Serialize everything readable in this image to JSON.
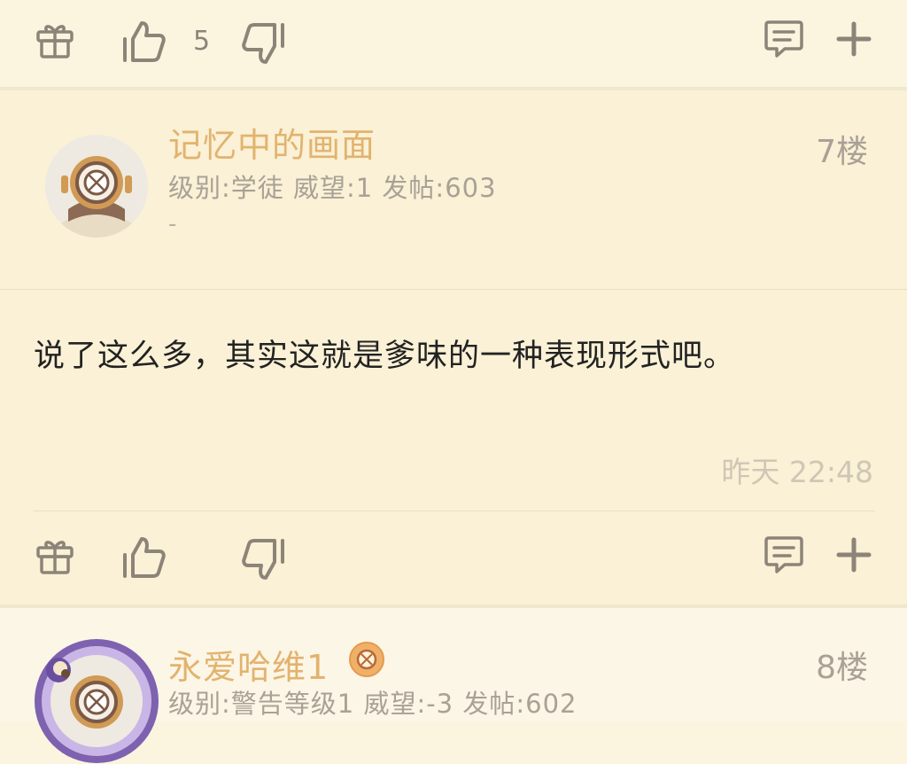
{
  "top_actions": {
    "like_count": "5"
  },
  "post7": {
    "username": "记忆中的画面",
    "meta": "级别:学徒 威望:1 发帖:603",
    "signature": "-",
    "floor": "7楼",
    "content": "说了这么多，其实这就是爹味的一种表现形式吧。",
    "time": "昨天 22:48"
  },
  "post8": {
    "username": "永爱哈维1",
    "meta": "级别:警告等级1 威望:-3 发帖:602",
    "floor": "8楼"
  },
  "icons": [
    "gift-icon",
    "thumbs-up-icon",
    "thumbs-down-icon",
    "comment-icon",
    "plus-icon",
    "avatar",
    "medal-icon"
  ]
}
